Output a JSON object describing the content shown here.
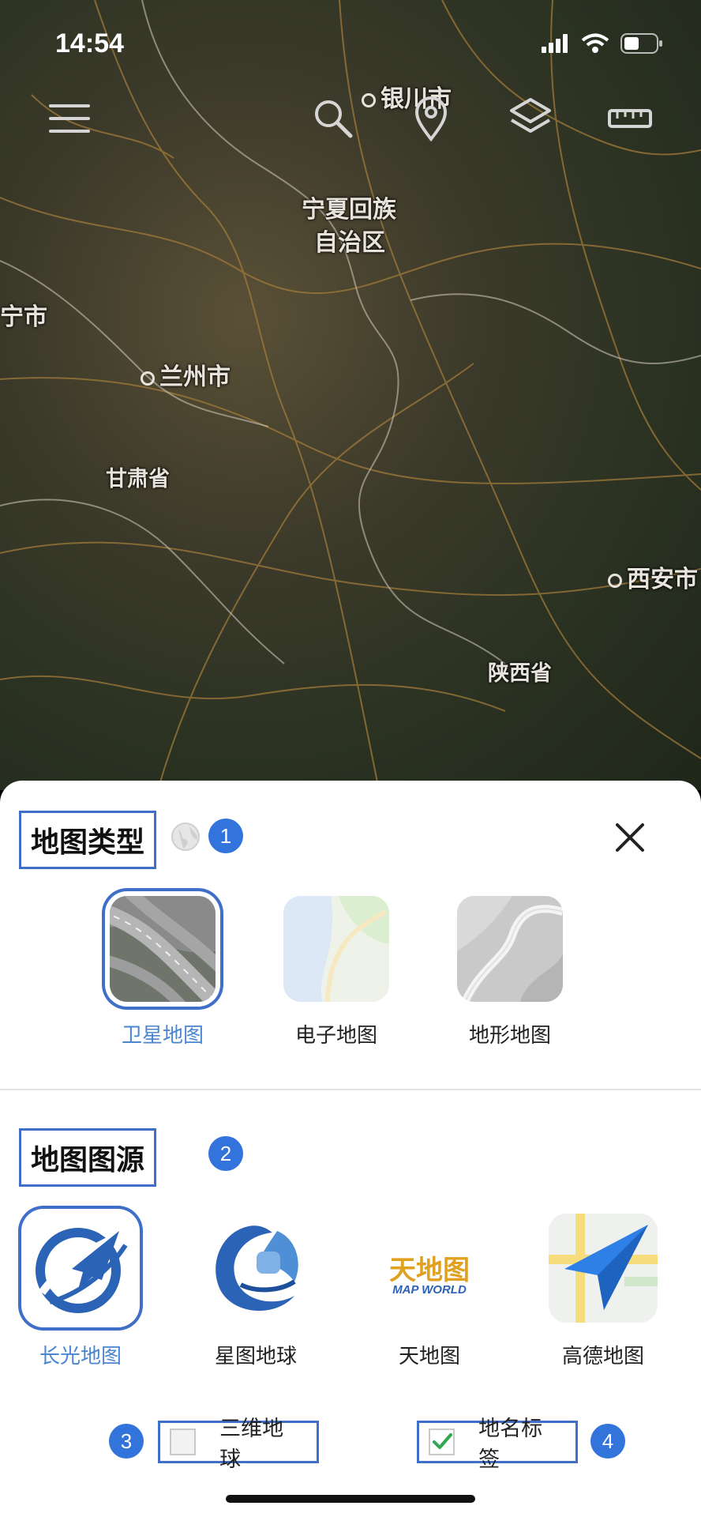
{
  "status_bar": {
    "time": "14:54"
  },
  "map": {
    "labels": {
      "yinchuan": "银川市",
      "ningxia_1": "宁夏回族",
      "ningxia_2": "自治区",
      "xining_partial": "宁市",
      "lanzhou": "兰州市",
      "gansu": "甘肃省",
      "xian": "西安市",
      "shaanxi": "陕西省"
    },
    "toolbar": {
      "menu_icon": "menu-icon",
      "search_icon": "search-icon",
      "location_icon": "location-pin-icon",
      "layers_icon": "layers-icon",
      "ruler_icon": "ruler-icon"
    }
  },
  "sheet": {
    "map_type": {
      "title": "地图类型",
      "badge": "1",
      "options": [
        {
          "label": "卫星地图",
          "selected": true
        },
        {
          "label": "电子地图",
          "selected": false
        },
        {
          "label": "地形地图",
          "selected": false
        }
      ]
    },
    "map_source": {
      "title": "地图图源",
      "badge": "2",
      "options": [
        {
          "label": "长光地图",
          "selected": true
        },
        {
          "label": "星图地球",
          "selected": false
        },
        {
          "label": "天地图",
          "selected": false,
          "logo_text": "天地图",
          "logo_sub": "MAP WORLD"
        },
        {
          "label": "高德地图",
          "selected": false
        }
      ]
    },
    "toggles": {
      "globe_3d": {
        "label": "三维地球",
        "checked": false,
        "badge": "3"
      },
      "place_names": {
        "label": "地名标签",
        "checked": true,
        "badge": "4"
      }
    }
  },
  "colors": {
    "accent": "#3f6fc8",
    "badge": "#3273dc",
    "selected_label": "#4a86d0"
  }
}
